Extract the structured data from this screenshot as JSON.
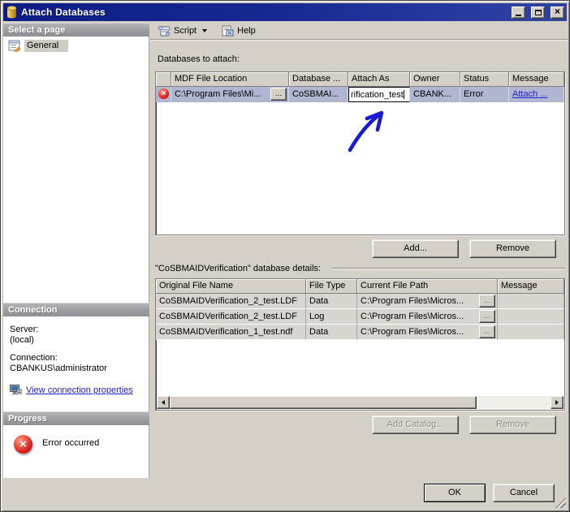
{
  "window": {
    "title": "Attach Databases"
  },
  "toolbar": {
    "script_label": "Script",
    "help_label": "Help"
  },
  "sidebar": {
    "select_page": {
      "header": "Select a page",
      "items": [
        {
          "label": "General"
        }
      ]
    },
    "connection": {
      "header": "Connection",
      "server_label": "Server:",
      "server_value": "(local)",
      "connection_label": "Connection:",
      "connection_value": "CBANKUS\\administrator",
      "link_label": "View connection properties"
    },
    "progress": {
      "header": "Progress",
      "status": "Error occurred"
    }
  },
  "main": {
    "attach_label": "Databases to attach:",
    "attach_grid": {
      "columns": [
        "",
        "MDF File Location",
        "Database ...",
        "Attach As",
        "Owner",
        "Status",
        "Message"
      ],
      "row": {
        "mdf_location": "C:\\Program Files\\Mi...",
        "browse": "...",
        "database_name": "CoSBMAI...",
        "attach_as": "rification_test",
        "owner": "CBANK...",
        "status": "Error",
        "message_link": "Attach ..."
      }
    },
    "add_button": "Add...",
    "remove_button": "Remove",
    "details_label": "\"CoSBMAIDVerification\" database details:",
    "details_grid": {
      "columns": [
        "Original File Name",
        "File Type",
        "Current File Path",
        "Message"
      ],
      "browse": "...",
      "rows": [
        {
          "name": "CoSBMAIDVerification_2_test.LDF",
          "type": "Data",
          "path": "C:\\Program Files\\Micros...",
          "message": ""
        },
        {
          "name": "CoSBMAIDVerification_2_test.LDF",
          "type": "Log",
          "path": "C:\\Program Files\\Micros...",
          "message": ""
        },
        {
          "name": "CoSBMAIDVerification_1_test.ndf",
          "type": "Data",
          "path": "C:\\Program Files\\Micros...",
          "message": ""
        }
      ]
    },
    "add_catalog_button": "Add Catalog...",
    "remove_catalog_button": "Remove",
    "ok_button": "OK",
    "cancel_button": "Cancel"
  },
  "colors": {
    "titlebar_blue": "#16288f",
    "dialog_gray": "#d4d0c8",
    "selection_blue": "#b0b6cf",
    "error_red": "#d01818",
    "link_blue": "#2222cc",
    "annotation_blue": "#1a1ad0"
  }
}
